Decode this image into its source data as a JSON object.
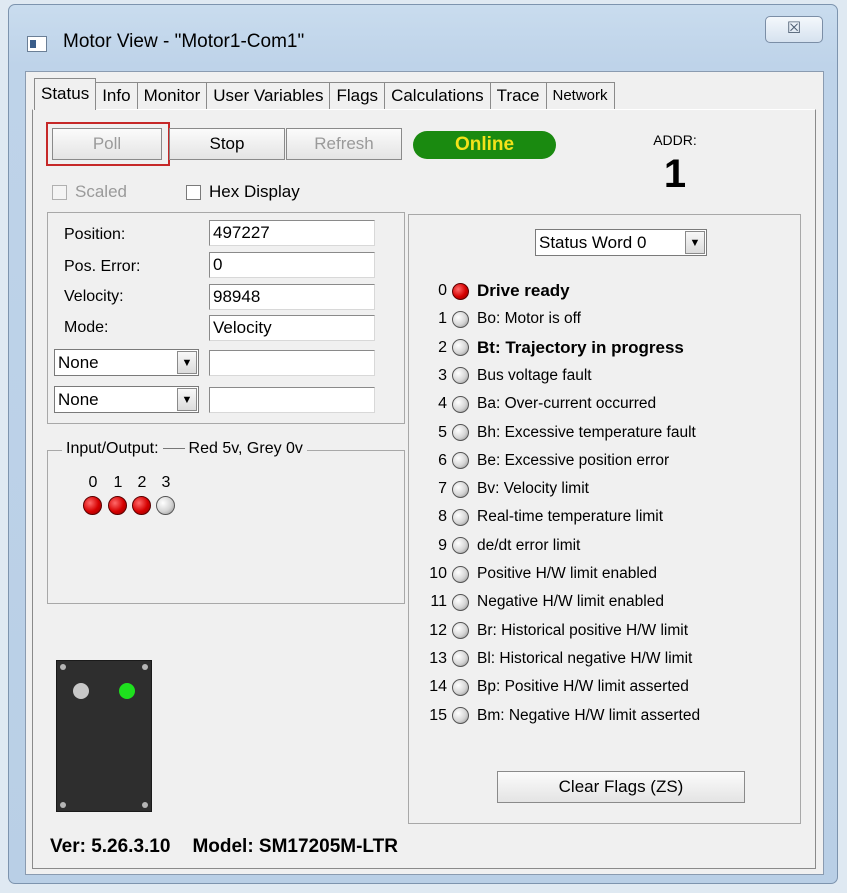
{
  "window": {
    "title": "Motor View - \"Motor1-Com1\"",
    "close_label": "☒"
  },
  "tabs": [
    {
      "label": "Status",
      "active": true
    },
    {
      "label": "Info",
      "active": false
    },
    {
      "label": "Monitor",
      "active": false
    },
    {
      "label": "User Variables",
      "active": false
    },
    {
      "label": "Flags",
      "active": false
    },
    {
      "label": "Calculations",
      "active": false
    },
    {
      "label": "Trace",
      "active": false
    },
    {
      "label": "Network",
      "active": false
    }
  ],
  "toolbar": {
    "poll_label": "Poll",
    "stop_label": "Stop",
    "refresh_label": "Refresh",
    "online_label": "Online",
    "online_color": "#1a8a10",
    "highlight_color": "#c62828"
  },
  "addr": {
    "label": "ADDR:",
    "value": "1"
  },
  "options": {
    "scaled_label": "Scaled",
    "scaled_checked": false,
    "hex_label": "Hex Display",
    "hex_checked": false
  },
  "fields": {
    "position_label": "Position:",
    "position_value": "497227",
    "pos_error_label": "Pos. Error:",
    "pos_error_value": "0",
    "velocity_label": "Velocity:",
    "velocity_value": "98948",
    "mode_label": "Mode:",
    "mode_value": "Velocity",
    "select1_value": "None",
    "select1_input": "",
    "select2_value": "None",
    "select2_input": ""
  },
  "io": {
    "legend_title": "Input/Output:",
    "legend_desc": "Red 5v, Grey 0v",
    "channels": [
      {
        "num": "0",
        "state": "red"
      },
      {
        "num": "1",
        "state": "red"
      },
      {
        "num": "2",
        "state": "red"
      },
      {
        "num": "3",
        "state": "grey"
      }
    ]
  },
  "footer": {
    "version": "Ver: 5.26.3.10",
    "model": "Model: SM17205M-LTR"
  },
  "status_panel": {
    "selector_value": "Status Word 0",
    "clear_label": "Clear Flags (ZS)",
    "bits": [
      {
        "num": "0",
        "state": "red",
        "text": "Drive ready",
        "bold": true
      },
      {
        "num": "1",
        "state": "grey",
        "text": "Bo:  Motor is off",
        "bold": false
      },
      {
        "num": "2",
        "state": "grey",
        "text": "Bt:  Trajectory in progress",
        "bold": true
      },
      {
        "num": "3",
        "state": "grey",
        "text": "Bus voltage fault",
        "bold": false
      },
      {
        "num": "4",
        "state": "grey",
        "text": "Ba:  Over-current occurred",
        "bold": false
      },
      {
        "num": "5",
        "state": "grey",
        "text": "Bh:  Excessive temperature fault",
        "bold": false
      },
      {
        "num": "6",
        "state": "grey",
        "text": "Be:  Excessive position error",
        "bold": false
      },
      {
        "num": "7",
        "state": "grey",
        "text": "Bv:  Velocity limit",
        "bold": false
      },
      {
        "num": "8",
        "state": "grey",
        "text": "Real-time temperature limit",
        "bold": false
      },
      {
        "num": "9",
        "state": "grey",
        "text": "de/dt error limit",
        "bold": false
      },
      {
        "num": "10",
        "state": "grey",
        "text": "Positive H/W limit enabled",
        "bold": false
      },
      {
        "num": "11",
        "state": "grey",
        "text": "Negative H/W limit enabled",
        "bold": false
      },
      {
        "num": "12",
        "state": "grey",
        "text": "Br:  Historical positive H/W limit",
        "bold": false
      },
      {
        "num": "13",
        "state": "grey",
        "text": "Bl:  Historical negative H/W limit",
        "bold": false
      },
      {
        "num": "14",
        "state": "grey",
        "text": "Bp:  Positive H/W limit asserted",
        "bold": false
      },
      {
        "num": "15",
        "state": "grey",
        "text": "Bm:  Negative H/W limit asserted",
        "bold": false
      }
    ]
  },
  "device_image": {
    "left_led_color": "#c8c8c8",
    "right_led_color": "#1ee01e"
  }
}
